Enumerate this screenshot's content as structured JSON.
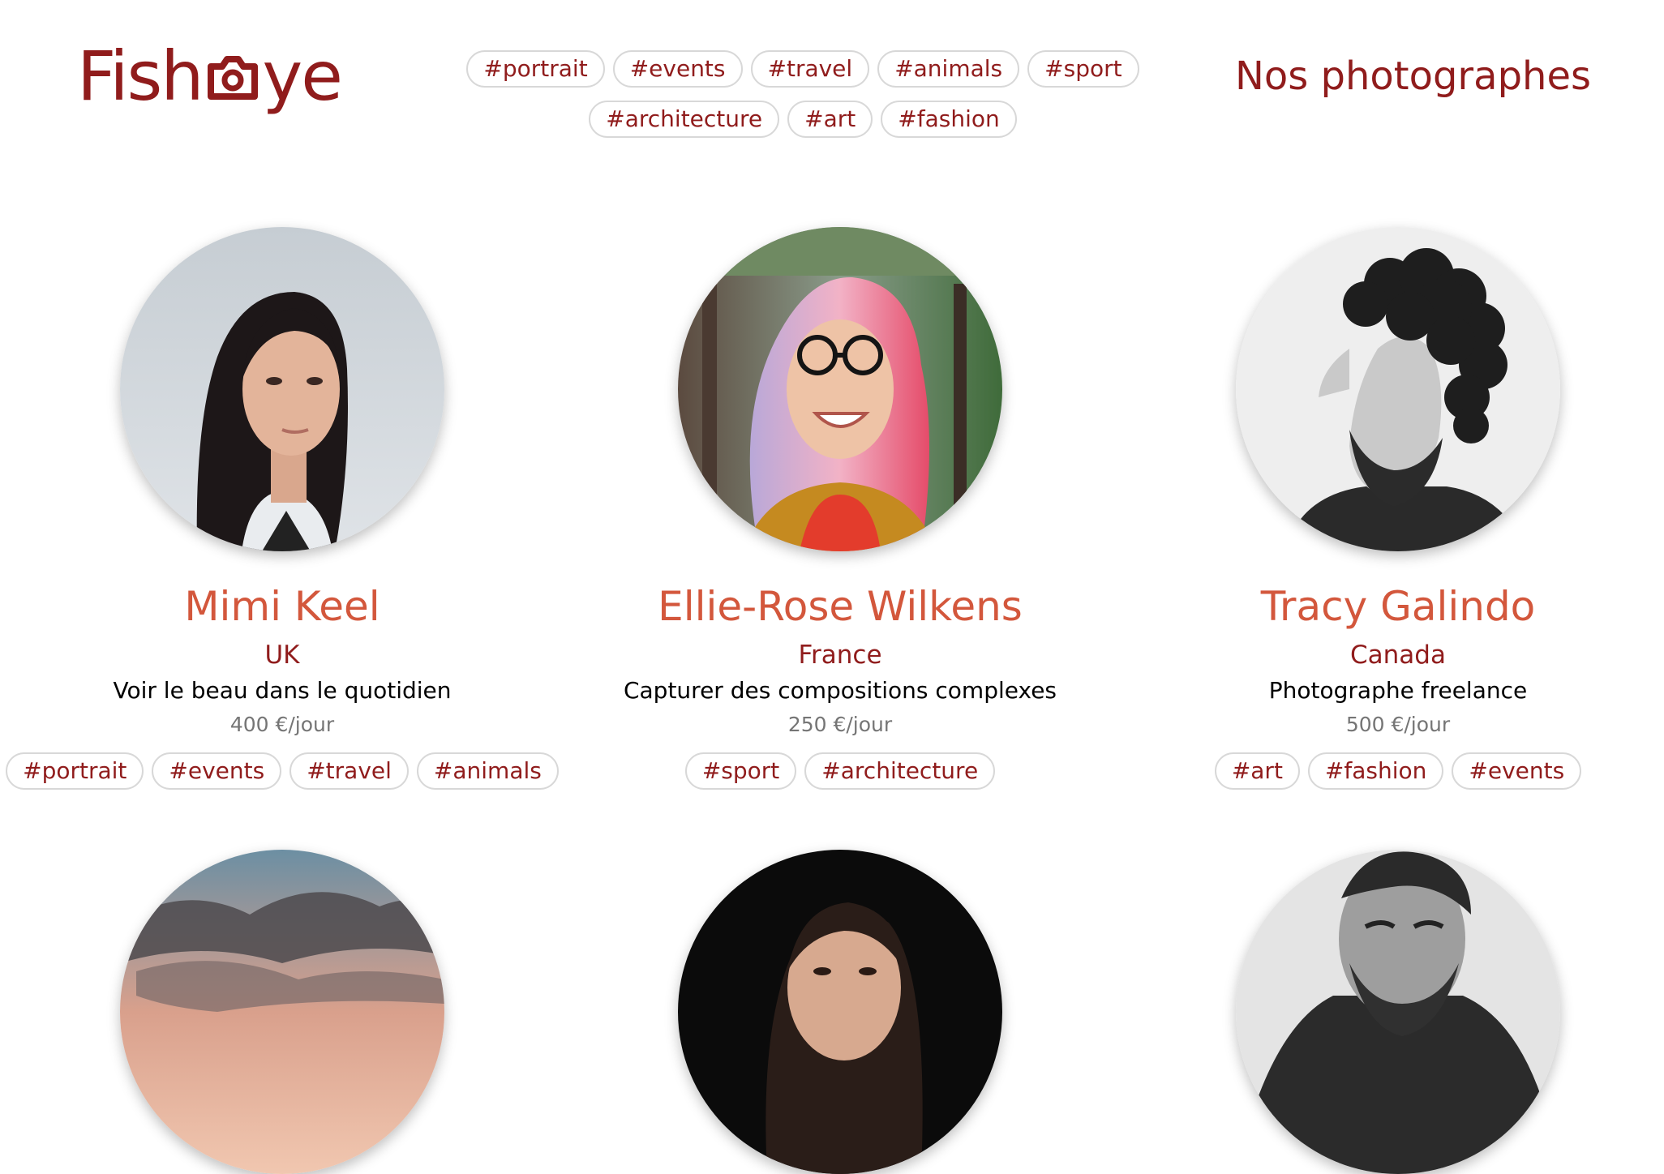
{
  "header": {
    "logo_text_left": "Fish",
    "logo_text_right": "ye",
    "nav_tags": [
      "#portrait",
      "#events",
      "#travel",
      "#animals",
      "#sport",
      "#architecture",
      "#art",
      "#fashion"
    ],
    "page_title": "Nos photographes"
  },
  "photographers": [
    {
      "name": "Mimi Keel",
      "location": "UK",
      "tagline": "Voir le beau dans le quotidien",
      "price": "400 €/jour",
      "tags": [
        "#portrait",
        "#events",
        "#travel",
        "#animals"
      ]
    },
    {
      "name": "Ellie-Rose Wilkens",
      "location": "France",
      "tagline": "Capturer des compositions complexes",
      "price": "250 €/jour",
      "tags": [
        "#sport",
        "#architecture"
      ]
    },
    {
      "name": "Tracy Galindo",
      "location": "Canada",
      "tagline": "Photographe freelance",
      "price": "500 €/jour",
      "tags": [
        "#art",
        "#fashion",
        "#events"
      ]
    }
  ],
  "colors": {
    "brand": "#901c1c",
    "name_accent": "#d3573c",
    "tag_border": "#d8d8d8",
    "price_gray": "#757575"
  }
}
